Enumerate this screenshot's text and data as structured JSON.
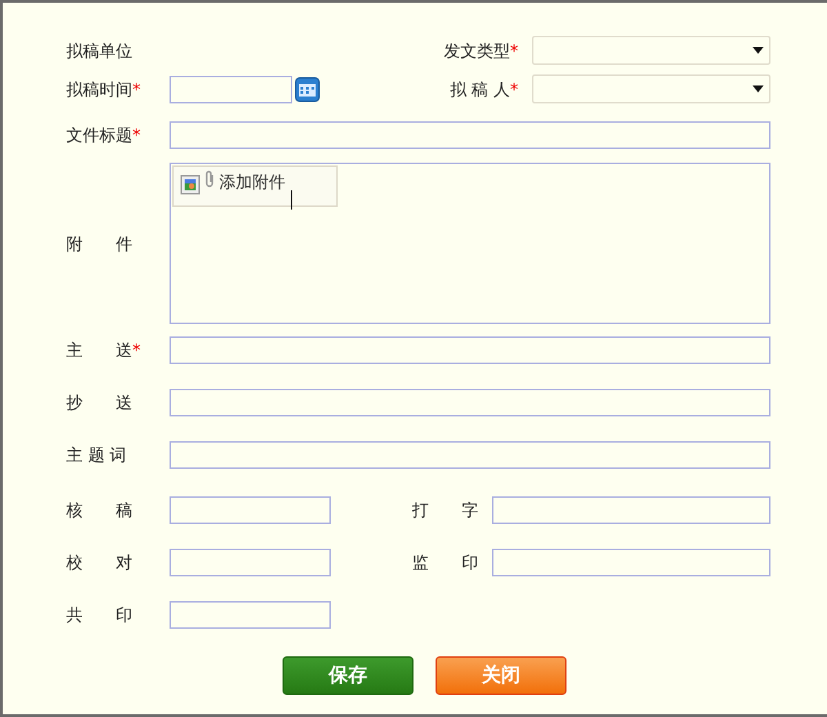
{
  "rows": [
    [
      {
        "label": "拟稿单位",
        "kind": "label"
      },
      {
        "label": "发文类型",
        "mark": "*",
        "kind": "select"
      }
    ],
    [
      {
        "label": "拟稿时间",
        "mark": "*",
        "kind": "date"
      },
      {
        "label": "拟 稿 人",
        "mark": "*",
        "kind": "select"
      }
    ],
    [
      {
        "label": "文件标题",
        "mark": "*",
        "kind": "text"
      }
    ],
    [
      {
        "label": "附　　件",
        "kind": "attachment",
        "button": "添加附件"
      }
    ],
    [
      {
        "label": "主　　送",
        "mark": "*",
        "kind": "text"
      }
    ],
    [
      {
        "label": "抄　　送",
        "kind": "text"
      }
    ],
    [
      {
        "label": "主 题 词",
        "kind": "text"
      }
    ],
    [
      {
        "label": "核　　稿",
        "kind": "short"
      },
      {
        "label": "打　　字",
        "kind": "short_right"
      }
    ],
    [
      {
        "label": "校　　对",
        "kind": "short"
      },
      {
        "label": "监　　印",
        "kind": "short_right"
      }
    ],
    [
      {
        "label": "共　　印",
        "kind": "short"
      }
    ]
  ],
  "buttons": [
    {
      "label": "保存",
      "kind": "primary"
    },
    {
      "label": "关闭",
      "kind": "danger"
    }
  ]
}
